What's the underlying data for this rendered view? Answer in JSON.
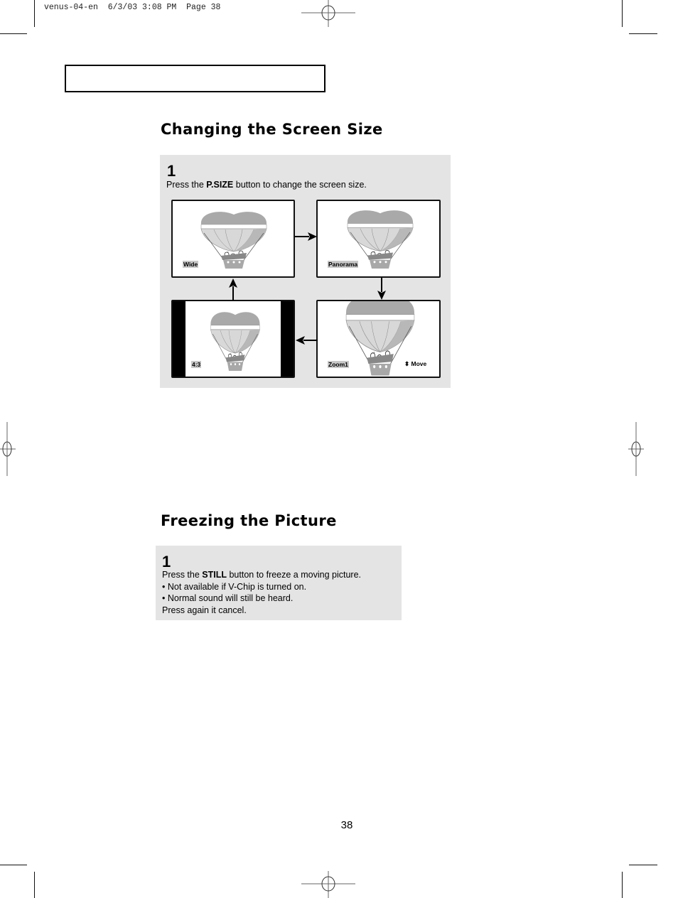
{
  "print_slug": "venus-04-en  6/3/03 3:08 PM  Page 38",
  "sections": [
    {
      "title": "Changing the Screen Size",
      "step": {
        "number": "1",
        "text_before": "Press the ",
        "bold": "P.SIZE",
        "text_after": " button to change the screen size."
      },
      "screens": [
        {
          "label": "Wide"
        },
        {
          "label": "Panorama"
        },
        {
          "label": "Zoom1",
          "hint": "Move",
          "hint_icon": "up-down-arrow-icon"
        },
        {
          "label": "4:3"
        }
      ]
    },
    {
      "title": "Freezing the Picture",
      "step": {
        "number": "1",
        "text_before": "Press the ",
        "bold": "STILL",
        "text_after": " button to freeze a moving picture.",
        "bullets": [
          "• Not available if V-Chip is turned on.",
          "• Normal sound will still be heard."
        ],
        "footer": "Press again it cancel."
      }
    }
  ],
  "page_number": "38"
}
